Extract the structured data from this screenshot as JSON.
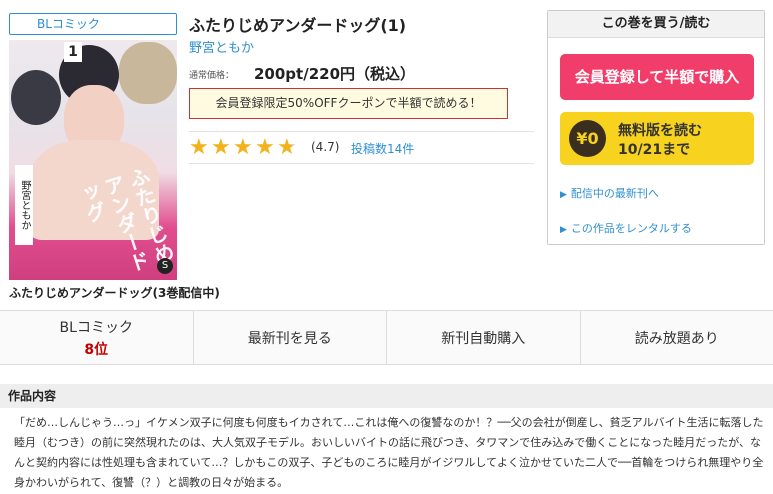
{
  "genre_badge": "BLコミック",
  "cover": {
    "volume_number": "1",
    "title_text": "ふたりじめアンダードッグ",
    "author_text": "野宮ともか",
    "logo_text": "S"
  },
  "book": {
    "title": "ふたりじめアンダードッグ(1)",
    "author": "野宮ともか",
    "price_label": "通常価格：",
    "price": "200pt/220円（税込）",
    "coupon": "会員登録限定50%OFFクーポンで半額で読める！",
    "rating": "(4.7)",
    "rating_value": 4.7,
    "reviews": "投稿数14件"
  },
  "buy_panel": {
    "header": "この巻を買う/読む",
    "register_button": "会員登録して半額で購入",
    "free_coin": "¥0",
    "free_line1": "無料版を読む",
    "free_line2": "10/21まで",
    "link_latest": "配信中の最新刊へ",
    "link_rental": "この作品をレンタルする"
  },
  "series_title": "ふたりじめアンダードッグ(3巻配信中)",
  "tabs": {
    "ranking_label": "BLコミック",
    "ranking_value": "8位",
    "latest": "最新刊を見る",
    "auto_buy": "新刊自動購入",
    "unlimited": "読み放題あり"
  },
  "summary": {
    "heading": "作品内容",
    "text": "「だめ…しんじゃう…っ」イケメン双子に何度も何度もイカされて…これは俺への復讐なのか！？──父の会社が倒産し、貧乏アルバイト生活に転落した睦月（むつき）の前に突然現れたのは、大人気双子モデル。おいしいバイトの話に飛びつき、タワマンで住み込みで働くことになった睦月だったが、なんと契約内容には性処理も含まれていて…？しかもこの双子、子どものころに睦月がイジワルしてよく泣かせていた二人で──首輪をつけられ無理やり全身かわいがられて、復讐（？）と調教の日々が始まる。"
  },
  "colors": {
    "accent_blue": "#2f8fd0",
    "register_pink": "#f03d6a",
    "free_yellow": "#f7d21e",
    "star": "#f2b21b",
    "rank_red": "#c30000"
  }
}
